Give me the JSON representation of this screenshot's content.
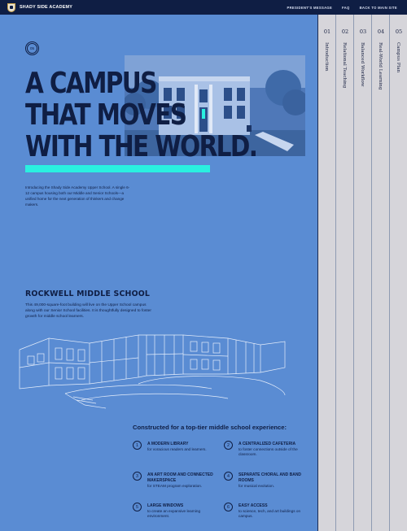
{
  "topbar": {
    "brand": "SHADY SIDE ACADEMY",
    "nav": [
      "PRESIDENT'S MESSAGE",
      "FAQ",
      "BACK TO MAIN SITE"
    ]
  },
  "sections": [
    {
      "num": "01",
      "label": "Introduction"
    },
    {
      "num": "02",
      "label": "Relational Teaching"
    },
    {
      "num": "03",
      "label": "Balanced Workflow"
    },
    {
      "num": "04",
      "label": "Real-World Learning"
    },
    {
      "num": "05",
      "label": "Campus Plan"
    }
  ],
  "hero": {
    "badge": "05",
    "title_lines": [
      "A CAMPUS",
      "THAT MOVES",
      "WITH THE WORLD."
    ],
    "intro": "Introducing the Shady Side Academy Upper School. A single 6-12 campus housing both our Middle and Senior Schools—a unified home for the next generation of thinkers and change makers."
  },
  "middle_school": {
    "heading": "ROCKWELL MIDDLE SCHOOL",
    "body": "This 49,000-square-foot building will live on the Upper School campus along with our Senior School facilities. It is thoughtfully designed to foster growth for middle school learners."
  },
  "features": {
    "heading": "Constructed for a top-tier middle school experience:",
    "items": [
      {
        "num": "1",
        "title": "A MODERN LIBRARY",
        "desc": "for voracious readers and learners."
      },
      {
        "num": "2",
        "title": "A CENTRALIZED CAFETERIA",
        "desc": "to foster connections outside of the classroom."
      },
      {
        "num": "3",
        "title": "AN ART ROOM AND CONNECTED MAKERSPACE",
        "desc": "for STEAM program exploration."
      },
      {
        "num": "4",
        "title": "SEPARATE CHORAL AND BAND ROOMS",
        "desc": "for musical evolution."
      },
      {
        "num": "5",
        "title": "LARGE WINDOWS",
        "desc": "to create an expansive learning environment."
      },
      {
        "num": "6",
        "title": "EASY ACCESS",
        "desc": "to science, tech, and art buildings on campus."
      }
    ]
  },
  "colors": {
    "background": "#5a8cd3",
    "navy": "#0f1e44",
    "accent": "#2af0e0",
    "tab": "#d6d5da"
  }
}
